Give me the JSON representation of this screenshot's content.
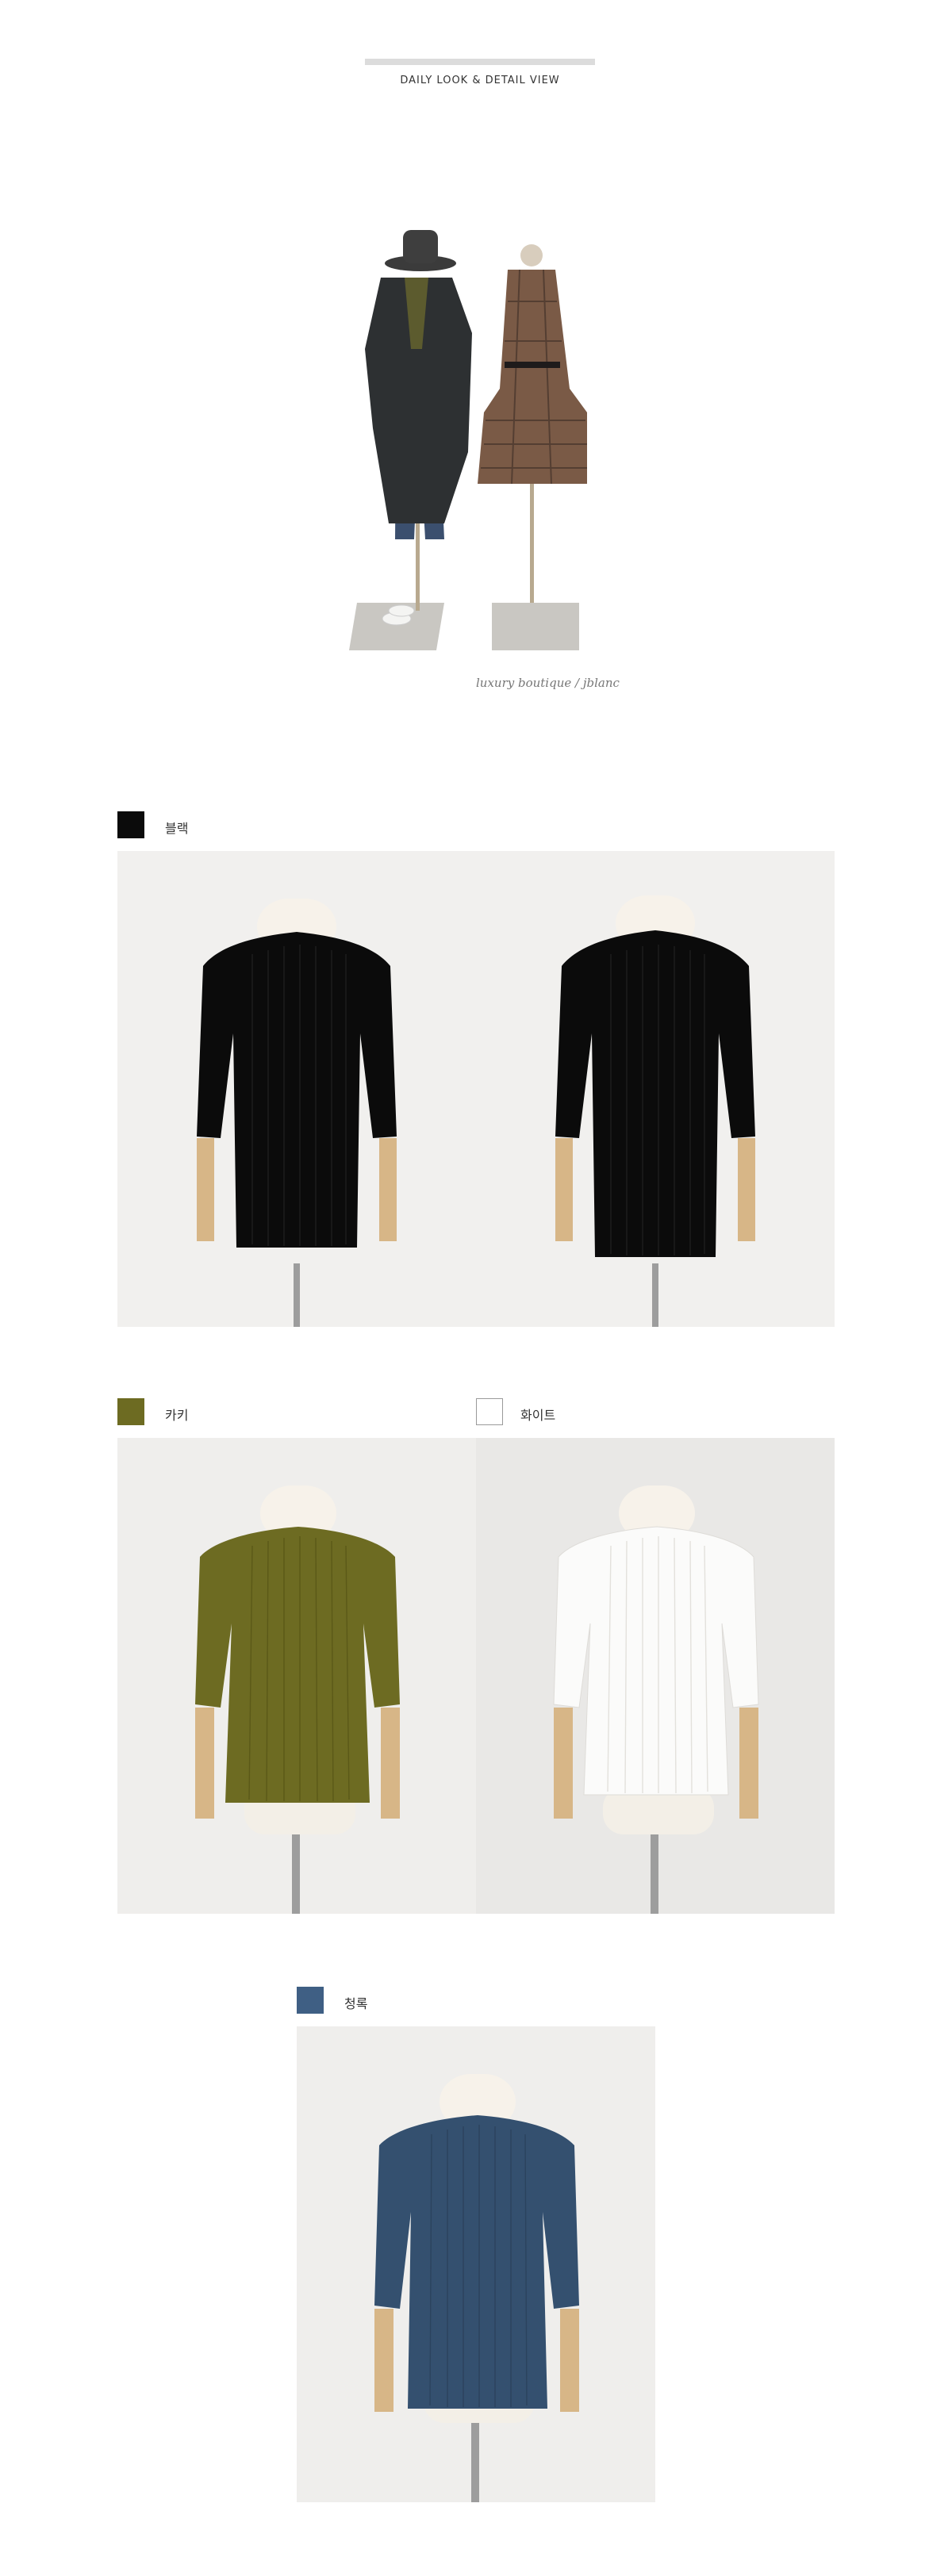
{
  "header": {
    "title": "DAILY LOOK & DETAIL VIEW"
  },
  "hero": {
    "signature": "luxury boutique / jblanc"
  },
  "colors": {
    "black": {
      "label": "블랙",
      "hex": "#0b0b0b"
    },
    "khaki": {
      "label": "카키",
      "hex": "#6d6b22"
    },
    "white": {
      "label": "화이트",
      "hex": "#ffffff"
    },
    "navy": {
      "label": "청록",
      "hex": "#3f5f84"
    }
  },
  "images": {
    "hero": "mannequins-daily-look",
    "black_front": "black-knit-front",
    "black_back": "black-knit-back",
    "khaki_front": "khaki-knit-front",
    "white_front": "white-knit-front",
    "navy_front": "navy-knit-front"
  }
}
